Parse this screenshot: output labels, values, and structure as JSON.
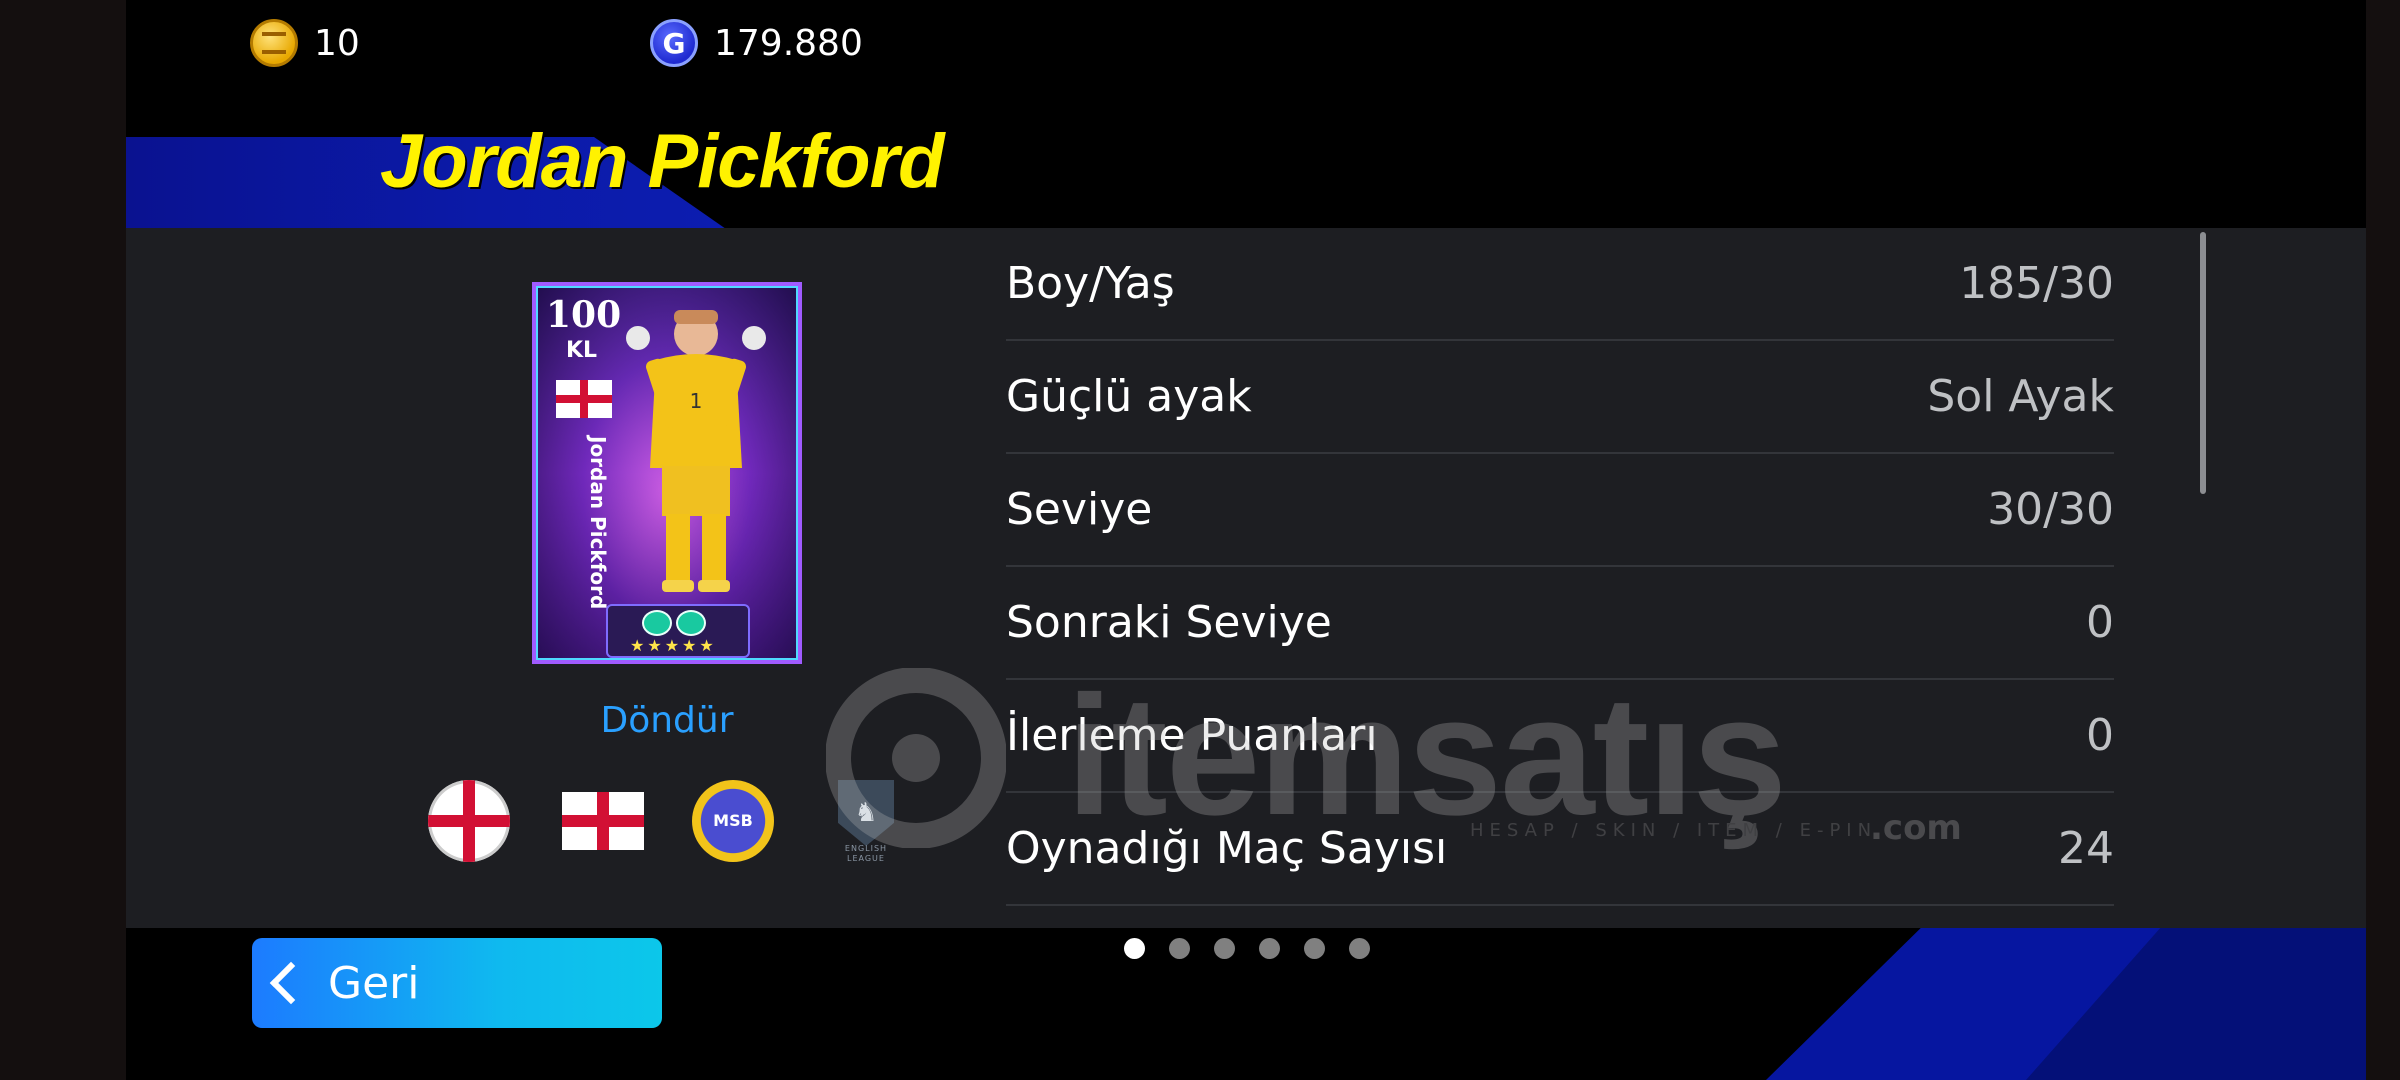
{
  "currency": {
    "coins_value": "10",
    "gp_value": "179.880",
    "coin_icon": "efootball-coin-icon",
    "gp_icon": "gp-icon",
    "gp_letter": "G"
  },
  "player": {
    "name": "Jordan Pickford",
    "card": {
      "rating": "100",
      "position": "KL",
      "vertical_name": "Jordan Pickford",
      "stars": "★★★★★"
    },
    "rotate_label": "Döndür"
  },
  "badges": {
    "nationality_round": "england-round-flag-icon",
    "nationality_flag": "england-flag-icon",
    "club": "club-crest-icon",
    "club_text": "MSB",
    "league": "english-league-icon",
    "league_text": "ENGLISH LEAGUE"
  },
  "stats": [
    {
      "label": "Boy/Yaş",
      "value": "185/30"
    },
    {
      "label": "Güçlü ayak",
      "value": "Sol Ayak"
    },
    {
      "label": "Seviye",
      "value": "30/30"
    },
    {
      "label": "Sonraki Seviye",
      "value": "0"
    },
    {
      "label": "İlerleme Puanları",
      "value": "0"
    },
    {
      "label": "Oynadığı Maç Sayısı",
      "value": "24"
    }
  ],
  "watermark": {
    "brand": "itemsatış",
    "tagline": "HESAP / SKIN / ITEM / E-PIN",
    "suffix": ".com"
  },
  "pager": {
    "total_pages": 6,
    "active_page": 1
  },
  "back_button": {
    "label": "Geri"
  },
  "colors": {
    "name": "#fff200",
    "accent_blue": "#2aa0ff",
    "panel": "#1d1e22",
    "back_button_start": "#1c7bff",
    "back_button_end": "#0cc7ea"
  }
}
